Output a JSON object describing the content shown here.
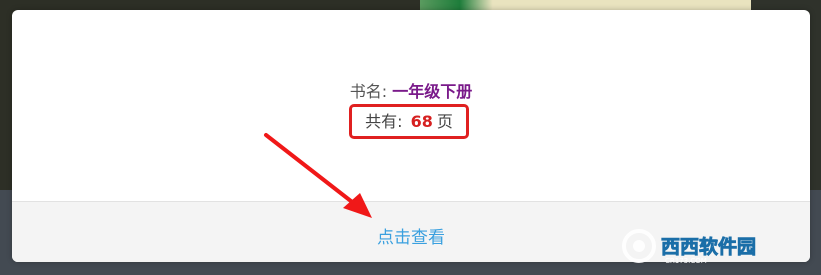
{
  "book": {
    "name_label": "书名:",
    "name_value": "一年级下册",
    "pages_label": "共有:",
    "pages_count": "68",
    "pages_unit": "页"
  },
  "footer": {
    "view_label": "点击查看"
  },
  "watermark": {
    "text": "西西软件园",
    "sub": "CR173.COM"
  },
  "colors": {
    "title_value": "#7a1a8a",
    "highlight_border": "#e02020",
    "link": "#3aa0df"
  }
}
